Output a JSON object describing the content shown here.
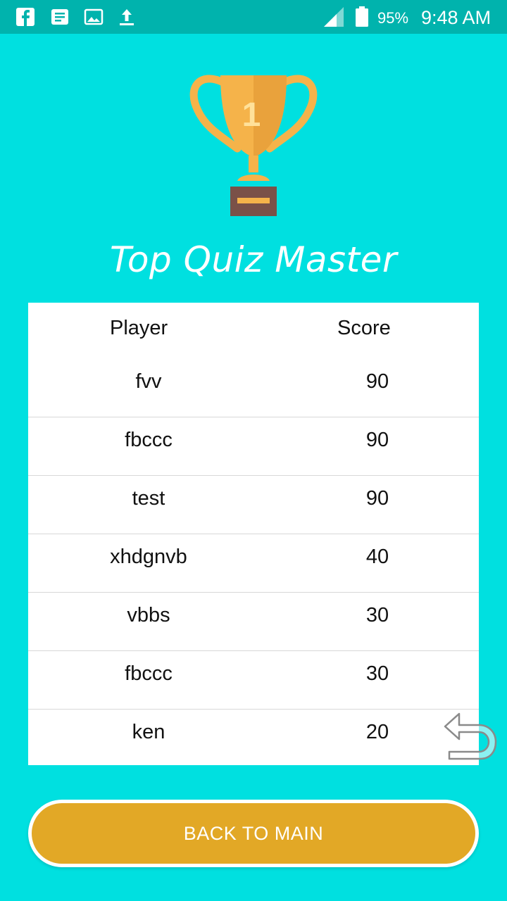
{
  "status_bar": {
    "battery_percent": "95%",
    "time": "9:48 AM",
    "icons": [
      "facebook-icon",
      "message-icon",
      "gallery-icon",
      "upload-icon",
      "signal-icon",
      "battery-icon"
    ]
  },
  "title": "Top Quiz Master",
  "trophy": {
    "rank_label": "1"
  },
  "leaderboard": {
    "headers": {
      "player": "Player",
      "score": "Score"
    },
    "rows": [
      {
        "player": "fvv",
        "score": "90"
      },
      {
        "player": "fbccc",
        "score": "90"
      },
      {
        "player": "test",
        "score": "90"
      },
      {
        "player": "xhdgnvb",
        "score": "40"
      },
      {
        "player": "vbbs",
        "score": "30"
      },
      {
        "player": "fbccc",
        "score": "30"
      },
      {
        "player": "ken",
        "score": "20"
      }
    ]
  },
  "back_button_label": "BACK TO MAIN",
  "colors": {
    "background": "#00e0e0",
    "status_bar": "#00b3ad",
    "button": "#e2a826",
    "trophy_cup": "#f5b34a"
  }
}
